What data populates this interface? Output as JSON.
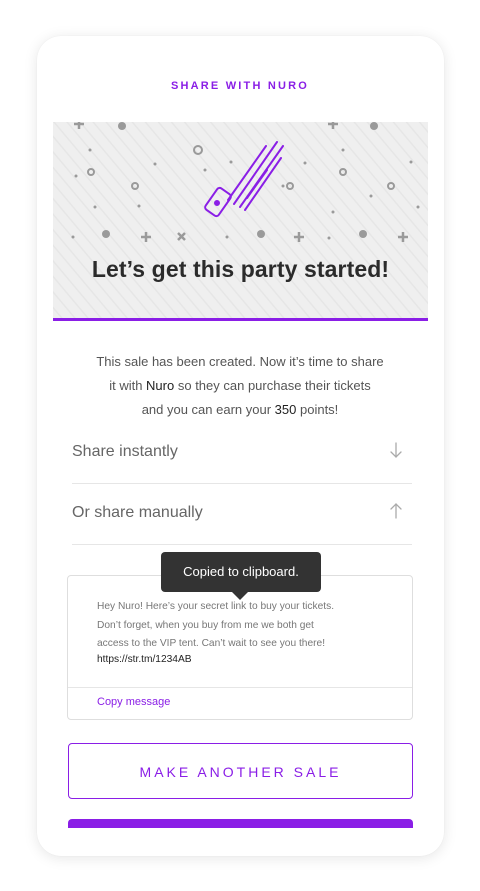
{
  "header": {
    "title": "SHARE WITH NURO"
  },
  "hero": {
    "title": "Let’s get this party started!",
    "illustration_icon": "shooting-star-ticket-icon"
  },
  "intro": {
    "line1_pre": "This sale has been created. Now it’s time to share",
    "line2_pre": "it with ",
    "buyer_name": "Nuro",
    "line2_post": " so they can purchase their tickets",
    "line3_pre": "and you can earn your ",
    "points": "350",
    "line3_post": " points!"
  },
  "share_instantly": {
    "label": "Share instantly",
    "icon": "arrow-down-icon"
  },
  "share_manually": {
    "label": "Or share manually",
    "icon": "arrow-up-icon"
  },
  "message": {
    "line1": "Hey Nuro! Here’s your secret link to buy your tickets.",
    "line2": "Don’t forget, when you buy from me we both get",
    "line3": "access to the VIP tent. Can’t wait to see you there!",
    "link": "https://str.tm/1234AB",
    "copy_label": "Copy message"
  },
  "tooltip": {
    "text": "Copied to clipboard."
  },
  "buttons": {
    "another_sale": "MAKE ANOTHER SALE"
  },
  "colors": {
    "accent": "#8a1ee6",
    "hero_bg": "#efefef",
    "tooltip_bg": "#333333"
  }
}
